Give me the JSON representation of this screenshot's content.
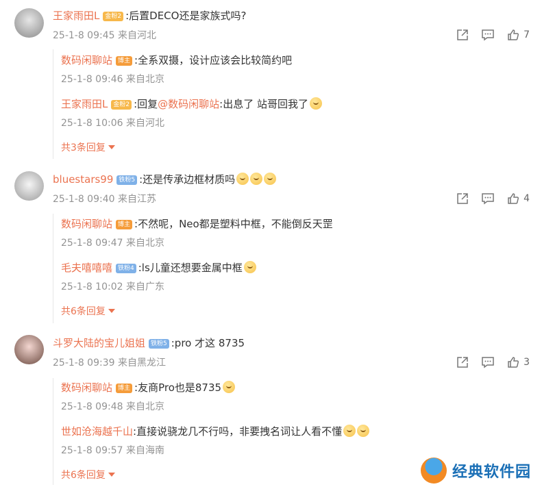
{
  "comments": [
    {
      "user": "王家雨田L",
      "badge": "金粉2",
      "text": ":后置DECO还是家族式吗?",
      "time": "25-1-8 09:45 来自河北",
      "likes": "7",
      "replies": [
        {
          "user": "数码闲聊站",
          "badge": "博主",
          "text": ":全系双摄，设计应该会比较简约吧",
          "time": "25-1-8 09:46 来自北京"
        },
        {
          "user": "王家雨田L",
          "badge": "金粉2",
          "text_prefix": ":回复",
          "mention": "@数码闲聊站",
          "text": ":出息了 站哥回我了",
          "time": "25-1-8 10:06 来自河北"
        }
      ],
      "more": "共3条回复"
    },
    {
      "user": "bluestars99",
      "badge": "铁粉5",
      "text": ":还是传承边框材质吗",
      "time": "25-1-8 09:40 来自江苏",
      "likes": "4",
      "replies": [
        {
          "user": "数码闲聊站",
          "badge": "博主",
          "text": ":不然呢，Neo都是塑料中框，不能倒反天罡",
          "time": "25-1-8 09:47 来自北京"
        },
        {
          "user": "毛夫嘻嘻嘻",
          "badge": "铁粉4",
          "text": ":ls儿童还想要金属中框",
          "time": "25-1-8 10:02 来自广东"
        }
      ],
      "more": "共6条回复"
    },
    {
      "user": "斗罗大陆的宝儿姐姐",
      "badge": "铁粉5",
      "text": ":pro 才这 8735",
      "time": "25-1-8 09:39 来自黑龙江",
      "likes": "3",
      "replies": [
        {
          "user": "数码闲聊站",
          "badge": "博主",
          "text": ":友商Pro也是8735",
          "time": "25-1-8 09:48 来自北京"
        },
        {
          "user": "世如沧海越千山",
          "badge": "",
          "text": ":直接说骁龙几不行吗，非要拽名词让人看不懂",
          "time": "25-1-8 09:57 来自海南"
        }
      ],
      "more": "共6条回复"
    }
  ],
  "watermark": "经典软件园",
  "colors": {
    "username": "#eb7350",
    "meta": "#939393",
    "text": "#333333"
  }
}
